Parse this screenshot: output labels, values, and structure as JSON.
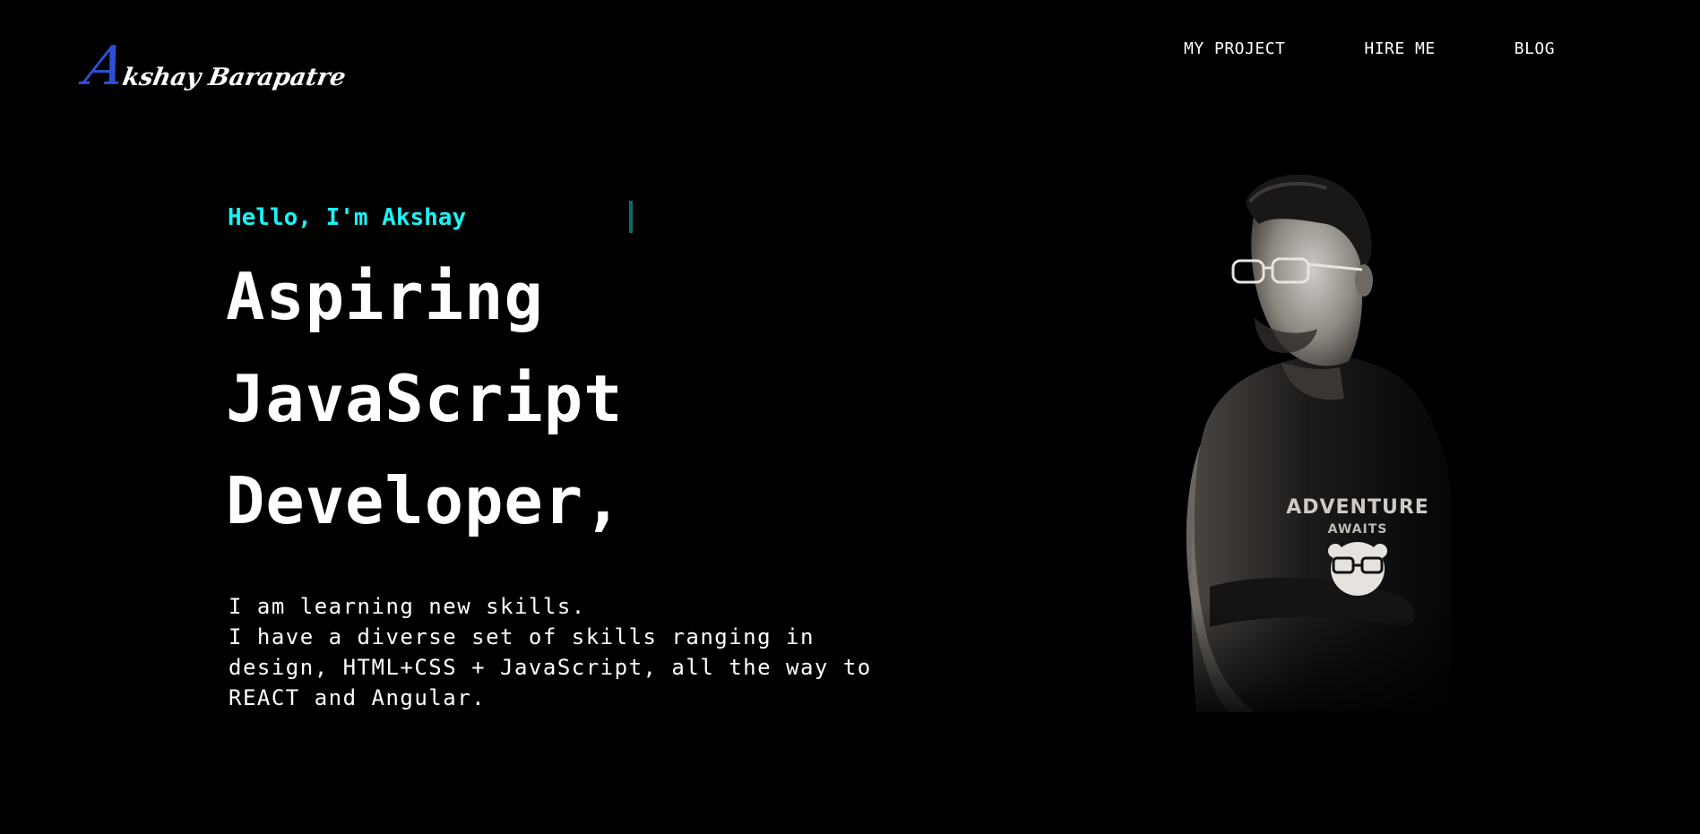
{
  "header": {
    "logo": {
      "initial": "A",
      "rest": "kshay Barapatre"
    },
    "nav": [
      {
        "label": "MY PROJECT"
      },
      {
        "label": "HIRE ME"
      },
      {
        "label": "BLOG"
      }
    ]
  },
  "hero": {
    "greeting": "Hello, I'm Akshay",
    "headline": [
      "Aspiring",
      "JavaScript",
      "Developer,"
    ],
    "bio": [
      "I am learning new skills.",
      "I have a diverse set of skills ranging in",
      "design, HTML+CSS + JavaScript, all the way to",
      "REACT and Angular."
    ],
    "portrait_shirt_text": [
      "ADVENTURE",
      "AWAITS"
    ]
  },
  "colors": {
    "background": "#000000",
    "accent": "#19f3f6",
    "logo_initial": "#2d4fd6",
    "text": "#ffffff"
  }
}
